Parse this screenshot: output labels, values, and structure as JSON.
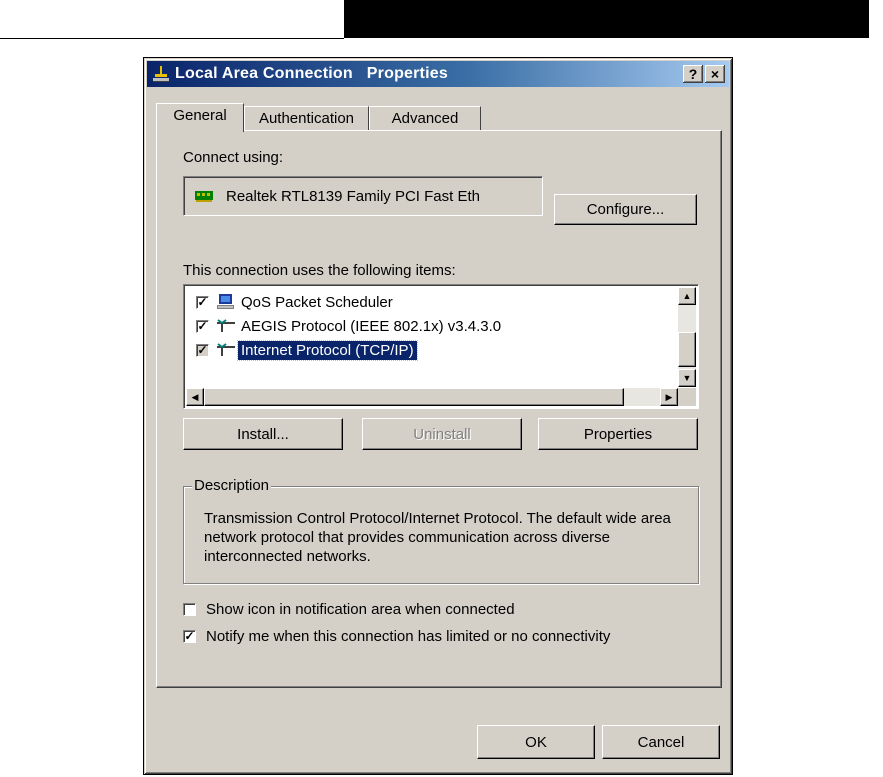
{
  "window": {
    "title": "Local Area Connection   Properties",
    "help_button": "?",
    "close_button": "×"
  },
  "tabs": [
    {
      "label": "General",
      "active": true
    },
    {
      "label": "Authentication",
      "active": false
    },
    {
      "label": "Advanced",
      "active": false
    }
  ],
  "general": {
    "connect_using_label": "Connect using:",
    "adapter_name": "Realtek RTL8139 Family PCI Fast Eth",
    "configure_button": "Configure...",
    "items_label": "This connection uses the following items:",
    "items": [
      {
        "label": "QoS Packet Scheduler",
        "checked": true,
        "selected": false,
        "icon": "qos-scheduler-icon"
      },
      {
        "label": "AEGIS Protocol (IEEE 802.1x) v3.4.3.0",
        "checked": true,
        "selected": false,
        "icon": "network-protocol-icon"
      },
      {
        "label": "Internet Protocol (TCP/IP)",
        "checked": true,
        "selected": true,
        "icon": "network-protocol-icon"
      }
    ],
    "install_button": "Install...",
    "uninstall_button": "Uninstall",
    "properties_button": "Properties",
    "description_legend": "Description",
    "description_text": "Transmission Control Protocol/Internet Protocol. The default wide area network protocol that provides communication across diverse interconnected networks.",
    "show_icon_label": "Show icon in notification area when connected",
    "show_icon_checked": false,
    "notify_label": "Notify me when this connection has limited or no connectivity",
    "notify_checked": true
  },
  "footer": {
    "ok_button": "OK",
    "cancel_button": "Cancel"
  },
  "colors": {
    "title_bar": "#0a246a",
    "dialog_face": "#d4d0c8",
    "selection": "#0a246a"
  }
}
